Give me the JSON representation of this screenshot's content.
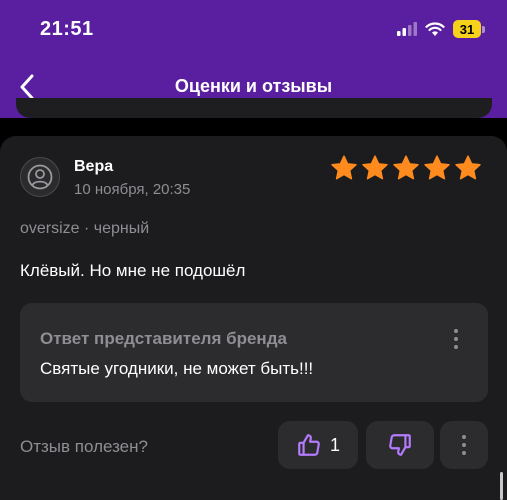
{
  "status_bar": {
    "time": "21:51",
    "battery": "31"
  },
  "nav": {
    "title": "Оценки и отзывы"
  },
  "review": {
    "author": "Вера",
    "date": "10 ноября, 20:35",
    "rating": 5,
    "variant": "oversize · черный",
    "text": "Клёвый. Но мне не подошёл",
    "reply": {
      "title": "Ответ представителя бренда",
      "text": "Святые угодники, не может быть!!!"
    },
    "helpful_label": "Отзыв полезен?",
    "likes": "1"
  },
  "colors": {
    "header": "#5a1fa0",
    "card": "#1c1c1e",
    "star": "#ff8a1e",
    "accent": "#b57bff"
  },
  "icons": [
    "chevron-left-icon",
    "user-icon",
    "star-icon",
    "thumbs-up-icon",
    "thumbs-down-icon",
    "more-vertical-icon",
    "signal-icon",
    "wifi-icon",
    "battery-icon"
  ]
}
